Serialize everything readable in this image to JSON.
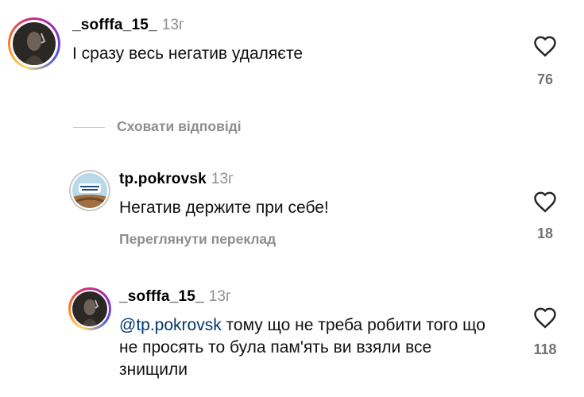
{
  "comments": [
    {
      "username": "_sofffa_15_",
      "time": "13г",
      "text": "І сразу весь негатив удаляєте",
      "likes": "76"
    },
    {
      "username": "tp.pokrovsk",
      "time": "13г",
      "text": "Негатив держите при себе!",
      "action": "Переглянути переклад",
      "likes": "18"
    },
    {
      "username": "_sofffa_15_",
      "time": "13г",
      "mention": "@tp.pokrovsk",
      "text": " тому що не треба робити того що не просять то була пам'ять ви взяли все знищили",
      "likes": "118"
    }
  ],
  "replies_toggle": "Сховати відповіді",
  "colors": {
    "muted": "#8e8e8e",
    "mention": "#00376b"
  },
  "icons": {
    "like": "heart-icon"
  }
}
